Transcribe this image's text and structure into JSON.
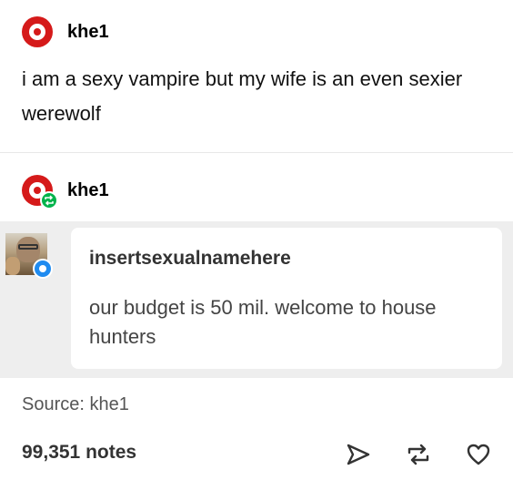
{
  "post": {
    "author": "khe1",
    "text": "i am a sexy vampire but my wife is an even sexier werewolf"
  },
  "reblog": {
    "author": "khe1"
  },
  "reply": {
    "author": "insertsexualnamehere",
    "text": "our budget is 50 mil. welcome to house hunters"
  },
  "footer": {
    "source": "Source: khe1",
    "notes": "99,351 notes"
  },
  "icons": {
    "share": "share-icon",
    "reblog": "reblog-icon",
    "like": "heart-icon"
  },
  "colors": {
    "accent_red": "#d51a1a",
    "reblog_green": "#00b34b",
    "chat_blue": "#1f8bf0"
  }
}
